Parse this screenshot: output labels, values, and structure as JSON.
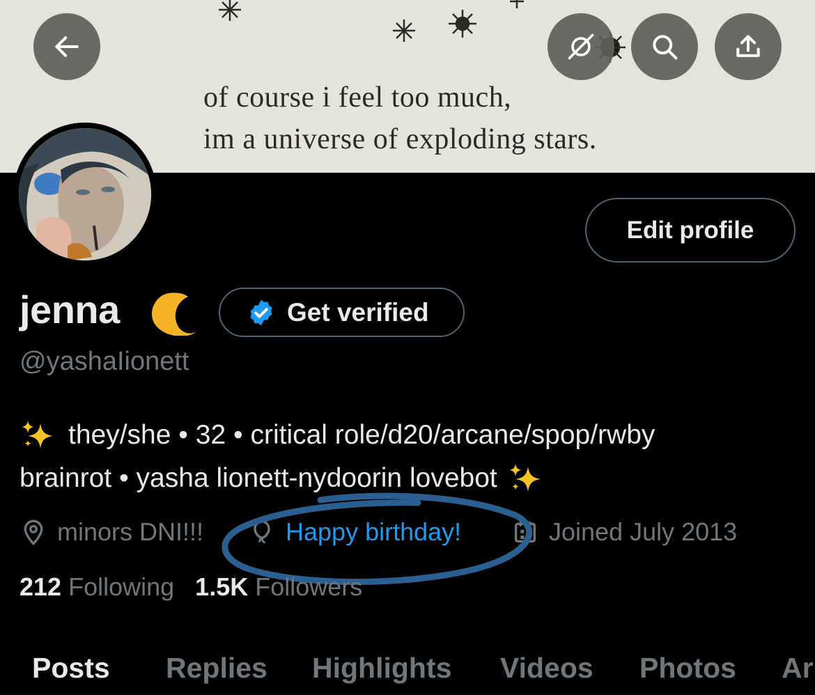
{
  "banner": {
    "quote_lines": [
      "of course i feel too much,",
      "im a universe of exploding stars."
    ]
  },
  "header_buttons": {
    "back_icon": "arrow-left-icon",
    "hide_icon": "eye-slash-icon",
    "search_icon": "search-icon",
    "share_icon": "share-upload-icon"
  },
  "profile": {
    "display_name": "jenna",
    "name_emoji": "crescent-moon",
    "handle": "@yashaIionett",
    "edit_profile_label": "Edit profile",
    "get_verified_label": "Get verified",
    "bio_line1": "they/she • 32 • critical role/d20/arcane/spop/rwby",
    "bio_line2": "brainrot • yasha lionett-nydoorin lovebot",
    "location": "minors DNI!!!",
    "birthday": "Happy birthday!",
    "joined": "Joined July 2013",
    "following_count": "212",
    "following_label": "Following",
    "followers_count": "1.5K",
    "followers_label": "Followers"
  },
  "tabs": [
    {
      "label": "Posts",
      "active": true
    },
    {
      "label": "Replies",
      "active": false
    },
    {
      "label": "Highlights",
      "active": false
    },
    {
      "label": "Videos",
      "active": false
    },
    {
      "label": "Photos",
      "active": false
    },
    {
      "label": "Ar",
      "active": false
    }
  ],
  "colors": {
    "accent_blue": "#1d9bf0",
    "muted_text": "#71767b",
    "border": "#536471",
    "annotation_circle": "#2c5f91"
  }
}
